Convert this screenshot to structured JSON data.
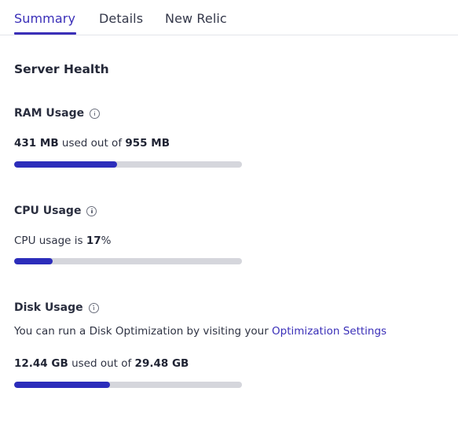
{
  "tabs": [
    {
      "label": "Summary",
      "active": true
    },
    {
      "label": "Details",
      "active": false
    },
    {
      "label": "New Relic",
      "active": false
    }
  ],
  "section_title": "Server Health",
  "ram": {
    "title": "RAM Usage",
    "used": "431 MB",
    "between": " used out of ",
    "total": "955 MB",
    "fraction": 0.451
  },
  "cpu": {
    "title": "CPU Usage",
    "prefix": "CPU usage is ",
    "value": "17",
    "suffix": "%",
    "fraction": 0.17
  },
  "disk": {
    "title": "Disk Usage",
    "note_text": "You can run a Disk Optimization by visiting your ",
    "note_link": "Optimization Settings",
    "used": "12.44 GB",
    "between": " used out of ",
    "total": "29.48 GB",
    "fraction": 0.422
  },
  "colors": {
    "accent": "#3a2fb8",
    "bar_fill": "#2c2dbb",
    "bar_track": "#d5d6dc"
  }
}
